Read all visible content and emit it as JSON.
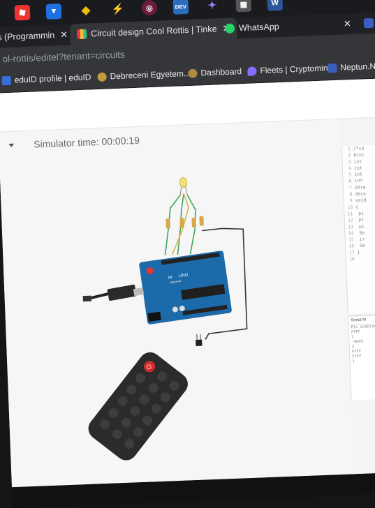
{
  "taskbar": {
    "icons": [
      "roblox-icon",
      "download-icon",
      "binance-icon",
      "bolt-icon",
      "app-icon",
      "dev-icon",
      "gamepad-icon",
      "calculator-icon",
      "word-icon"
    ],
    "dev_label": "DEV",
    "word_label": "W"
  },
  "tabs": [
    {
      "label": "s (Programmin",
      "close": "✕"
    },
    {
      "label": "Circuit design Cool Rottis | Tinke",
      "close": "✕"
    },
    {
      "label": "WhatsApp",
      "close": "✕"
    }
  ],
  "address": {
    "url": "ol-rottis/editel?tenant=circuits"
  },
  "bookmarks": [
    {
      "label": "eduID profile | eduID"
    },
    {
      "label": "Debreceni Egyetem..."
    },
    {
      "label": "Dashboard"
    },
    {
      "label": "Fleets | Cryptomines"
    },
    {
      "label": "Neptun.Net"
    }
  ],
  "simulator": {
    "time_label": "Simulator time: 00:00:19"
  },
  "code_lines": [
    {
      "n": "1",
      "t": "/*co"
    },
    {
      "n": "2",
      "t": "#inc"
    },
    {
      "n": "3",
      "t": "int"
    },
    {
      "n": "4",
      "t": "int"
    },
    {
      "n": "5",
      "t": "int"
    },
    {
      "n": "6",
      "t": "int"
    },
    {
      "n": "7",
      "t": "IRre"
    },
    {
      "n": "8",
      "t": "deco"
    },
    {
      "n": "9",
      "t": "void"
    },
    {
      "n": "10",
      "t": "{"
    },
    {
      "n": "11",
      "t": "  pi"
    },
    {
      "n": "12",
      "t": "  pi"
    },
    {
      "n": "13",
      "t": "  pi"
    },
    {
      "n": "14",
      "t": "  Se"
    },
    {
      "n": "15",
      "t": "  ir"
    },
    {
      "n": "16",
      "t": "  Se"
    },
    {
      "n": "17",
      "t": "}"
    },
    {
      "n": "18",
      "t": ""
    }
  ],
  "serial": {
    "title": "Serial M",
    "lines": [
      "Pin_enabled",
      "FFFF",
      "1",
      "-9005",
      "3",
      "FFFF",
      "FFFF",
      "1"
    ]
  },
  "arduino": {
    "brand": "ARDUINO",
    "model": "UNO"
  },
  "colors": {
    "accent_red": "#d52a2a",
    "board": "#1c6aa9",
    "remote": "#2b2b2b"
  }
}
